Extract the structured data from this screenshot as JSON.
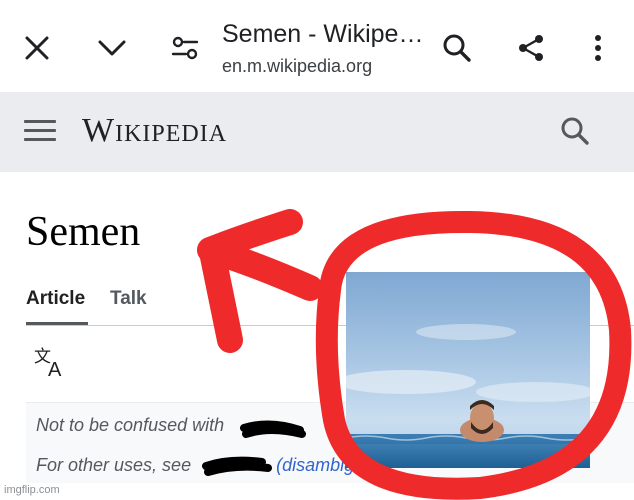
{
  "browser": {
    "title": "Semen - Wikipe…",
    "url": "en.m.wikipedia.org"
  },
  "wiki": {
    "wordmark": "Wikipedia"
  },
  "article": {
    "title": "Semen",
    "tabs": [
      {
        "label": "Article"
      },
      {
        "label": "Talk"
      }
    ],
    "hatnote": {
      "line1": "Not to be confused with",
      "line2_prefix": "For other uses, see",
      "line2_suffix": "(disambig"
    }
  },
  "colors": {
    "scribble_red": "#ee2a2a",
    "link_blue": "#3366cc",
    "header_gray": "#eaecf0"
  },
  "icons": [
    "close-icon",
    "chevron-down-icon",
    "tune-icon",
    "search-icon",
    "share-icon",
    "more-vert-icon",
    "hamburger-icon",
    "translate-icon"
  ],
  "watermark": "imgflip.com"
}
